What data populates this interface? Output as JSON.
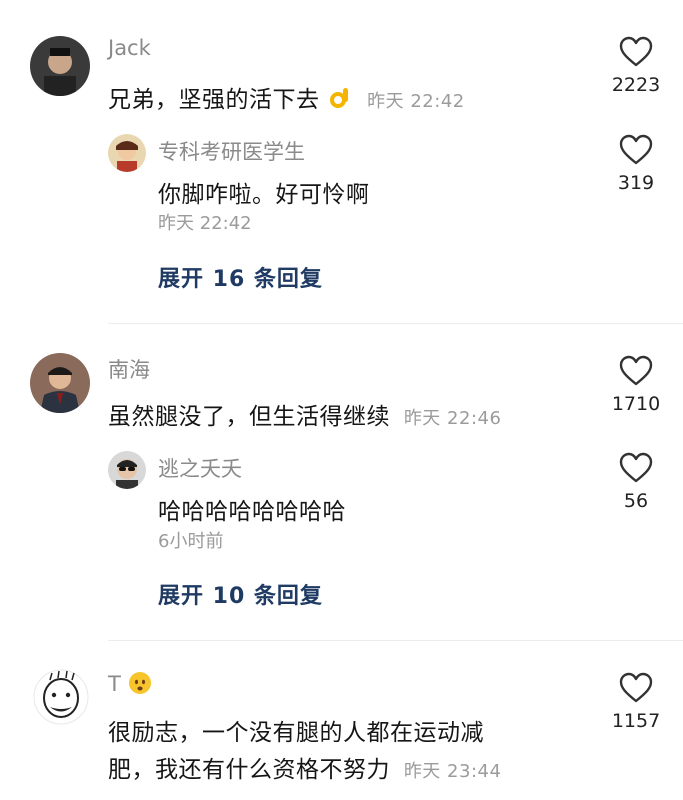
{
  "comments": [
    {
      "name": "Jack",
      "text": "兄弟，坚强的活下去",
      "time": "昨天 22:42",
      "likes": "2223",
      "reply": {
        "name": "专科考研医学生",
        "text": "你脚咋啦。好可怜啊",
        "time": "昨天 22:42",
        "likes": "319"
      },
      "expand": "展开 16 条回复"
    },
    {
      "name": "南海",
      "text": "虽然腿没了，但生活得继续",
      "time": "昨天 22:46",
      "likes": "1710",
      "reply": {
        "name": "逃之夭夭",
        "text": "哈哈哈哈哈哈哈哈",
        "time": "6小时前",
        "likes": "56"
      },
      "expand": "展开 10 条回复"
    },
    {
      "name": "T",
      "text_line1": "很励志，一个没有腿的人都在运动减",
      "text_line2": "肥，我还有什么资格不努力",
      "time": "昨天 23:44",
      "likes": "1157"
    }
  ],
  "icons": {
    "like": "heart-outline-icon",
    "ok_emoji": "ok-hand-emoji",
    "worried_emoji": "worried-face-emoji"
  }
}
